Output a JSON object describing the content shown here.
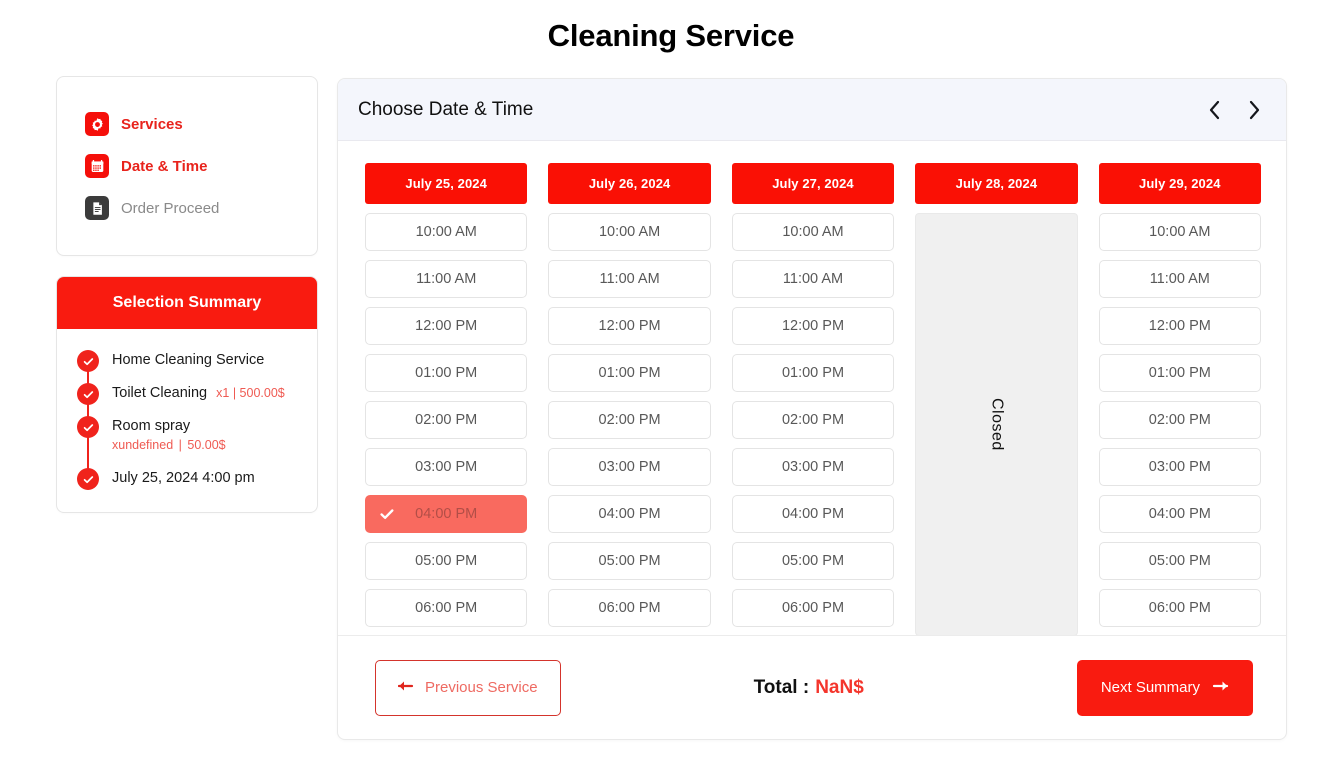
{
  "page": {
    "title": "Cleaning Service",
    "accent_red": "#f91b10",
    "selected_slot_color": "#f96a5f",
    "closed_bg": "#f0f0f0"
  },
  "steps": {
    "items": [
      {
        "label": "Services",
        "icon": "gear-icon",
        "state": "active",
        "icon_color": "#f50f0a"
      },
      {
        "label": "Date & Time",
        "icon": "calendar-icon",
        "state": "active",
        "icon_color": "#f50f0a"
      },
      {
        "label": "Order Proceed",
        "icon": "document-icon",
        "state": "inactive",
        "icon_color": "#3b3b3b"
      }
    ]
  },
  "summary": {
    "heading": "Selection Summary",
    "items": [
      {
        "title": "Home Cleaning Service",
        "meta_qty": "",
        "meta_sep": "",
        "meta_price": "",
        "inline": true
      },
      {
        "title": "Toilet Cleaning",
        "meta_qty": "x1",
        "meta_sep": "|",
        "meta_price": "500.00$",
        "inline": true
      },
      {
        "title": "Room spray",
        "meta_qty": "xundefined",
        "meta_sep": "|",
        "meta_price": "50.00$",
        "inline": false
      },
      {
        "title": "July 25, 2024 4:00 pm",
        "meta_qty": "",
        "meta_sep": "",
        "meta_price": "",
        "inline": true
      }
    ]
  },
  "panel": {
    "header_title": "Choose Date & Time",
    "prev_arrow": "chevron-left",
    "next_arrow": "chevron-right"
  },
  "schedule": {
    "days": [
      {
        "date_label": "July 25, 2024",
        "closed": false,
        "closed_label": "",
        "slots": [
          {
            "time": "10:00 AM",
            "selected": false
          },
          {
            "time": "11:00 AM",
            "selected": false
          },
          {
            "time": "12:00 PM",
            "selected": false
          },
          {
            "time": "01:00 PM",
            "selected": false
          },
          {
            "time": "02:00 PM",
            "selected": false
          },
          {
            "time": "03:00 PM",
            "selected": false
          },
          {
            "time": "04:00 PM",
            "selected": true
          },
          {
            "time": "05:00 PM",
            "selected": false
          },
          {
            "time": "06:00 PM",
            "selected": false
          }
        ]
      },
      {
        "date_label": "July 26, 2024",
        "closed": false,
        "closed_label": "",
        "slots": [
          {
            "time": "10:00 AM",
            "selected": false
          },
          {
            "time": "11:00 AM",
            "selected": false
          },
          {
            "time": "12:00 PM",
            "selected": false
          },
          {
            "time": "01:00 PM",
            "selected": false
          },
          {
            "time": "02:00 PM",
            "selected": false
          },
          {
            "time": "03:00 PM",
            "selected": false
          },
          {
            "time": "04:00 PM",
            "selected": false
          },
          {
            "time": "05:00 PM",
            "selected": false
          },
          {
            "time": "06:00 PM",
            "selected": false
          }
        ]
      },
      {
        "date_label": "July 27, 2024",
        "closed": false,
        "closed_label": "",
        "slots": [
          {
            "time": "10:00 AM",
            "selected": false
          },
          {
            "time": "11:00 AM",
            "selected": false
          },
          {
            "time": "12:00 PM",
            "selected": false
          },
          {
            "time": "01:00 PM",
            "selected": false
          },
          {
            "time": "02:00 PM",
            "selected": false
          },
          {
            "time": "03:00 PM",
            "selected": false
          },
          {
            "time": "04:00 PM",
            "selected": false
          },
          {
            "time": "05:00 PM",
            "selected": false
          },
          {
            "time": "06:00 PM",
            "selected": false
          }
        ]
      },
      {
        "date_label": "July 28, 2024",
        "closed": true,
        "closed_label": "Closed",
        "slots": []
      },
      {
        "date_label": "July 29, 2024",
        "closed": false,
        "closed_label": "",
        "slots": [
          {
            "time": "10:00 AM",
            "selected": false
          },
          {
            "time": "11:00 AM",
            "selected": false
          },
          {
            "time": "12:00 PM",
            "selected": false
          },
          {
            "time": "01:00 PM",
            "selected": false
          },
          {
            "time": "02:00 PM",
            "selected": false
          },
          {
            "time": "03:00 PM",
            "selected": false
          },
          {
            "time": "04:00 PM",
            "selected": false
          },
          {
            "time": "05:00 PM",
            "selected": false
          },
          {
            "time": "06:00 PM",
            "selected": false
          }
        ]
      }
    ]
  },
  "footer": {
    "prev_label": "Previous Service",
    "prev_arrow": "arrow-left",
    "total_label": "Total :",
    "total_value": "NaN$",
    "next_label": "Next Summary",
    "next_arrow": "arrow-right"
  }
}
